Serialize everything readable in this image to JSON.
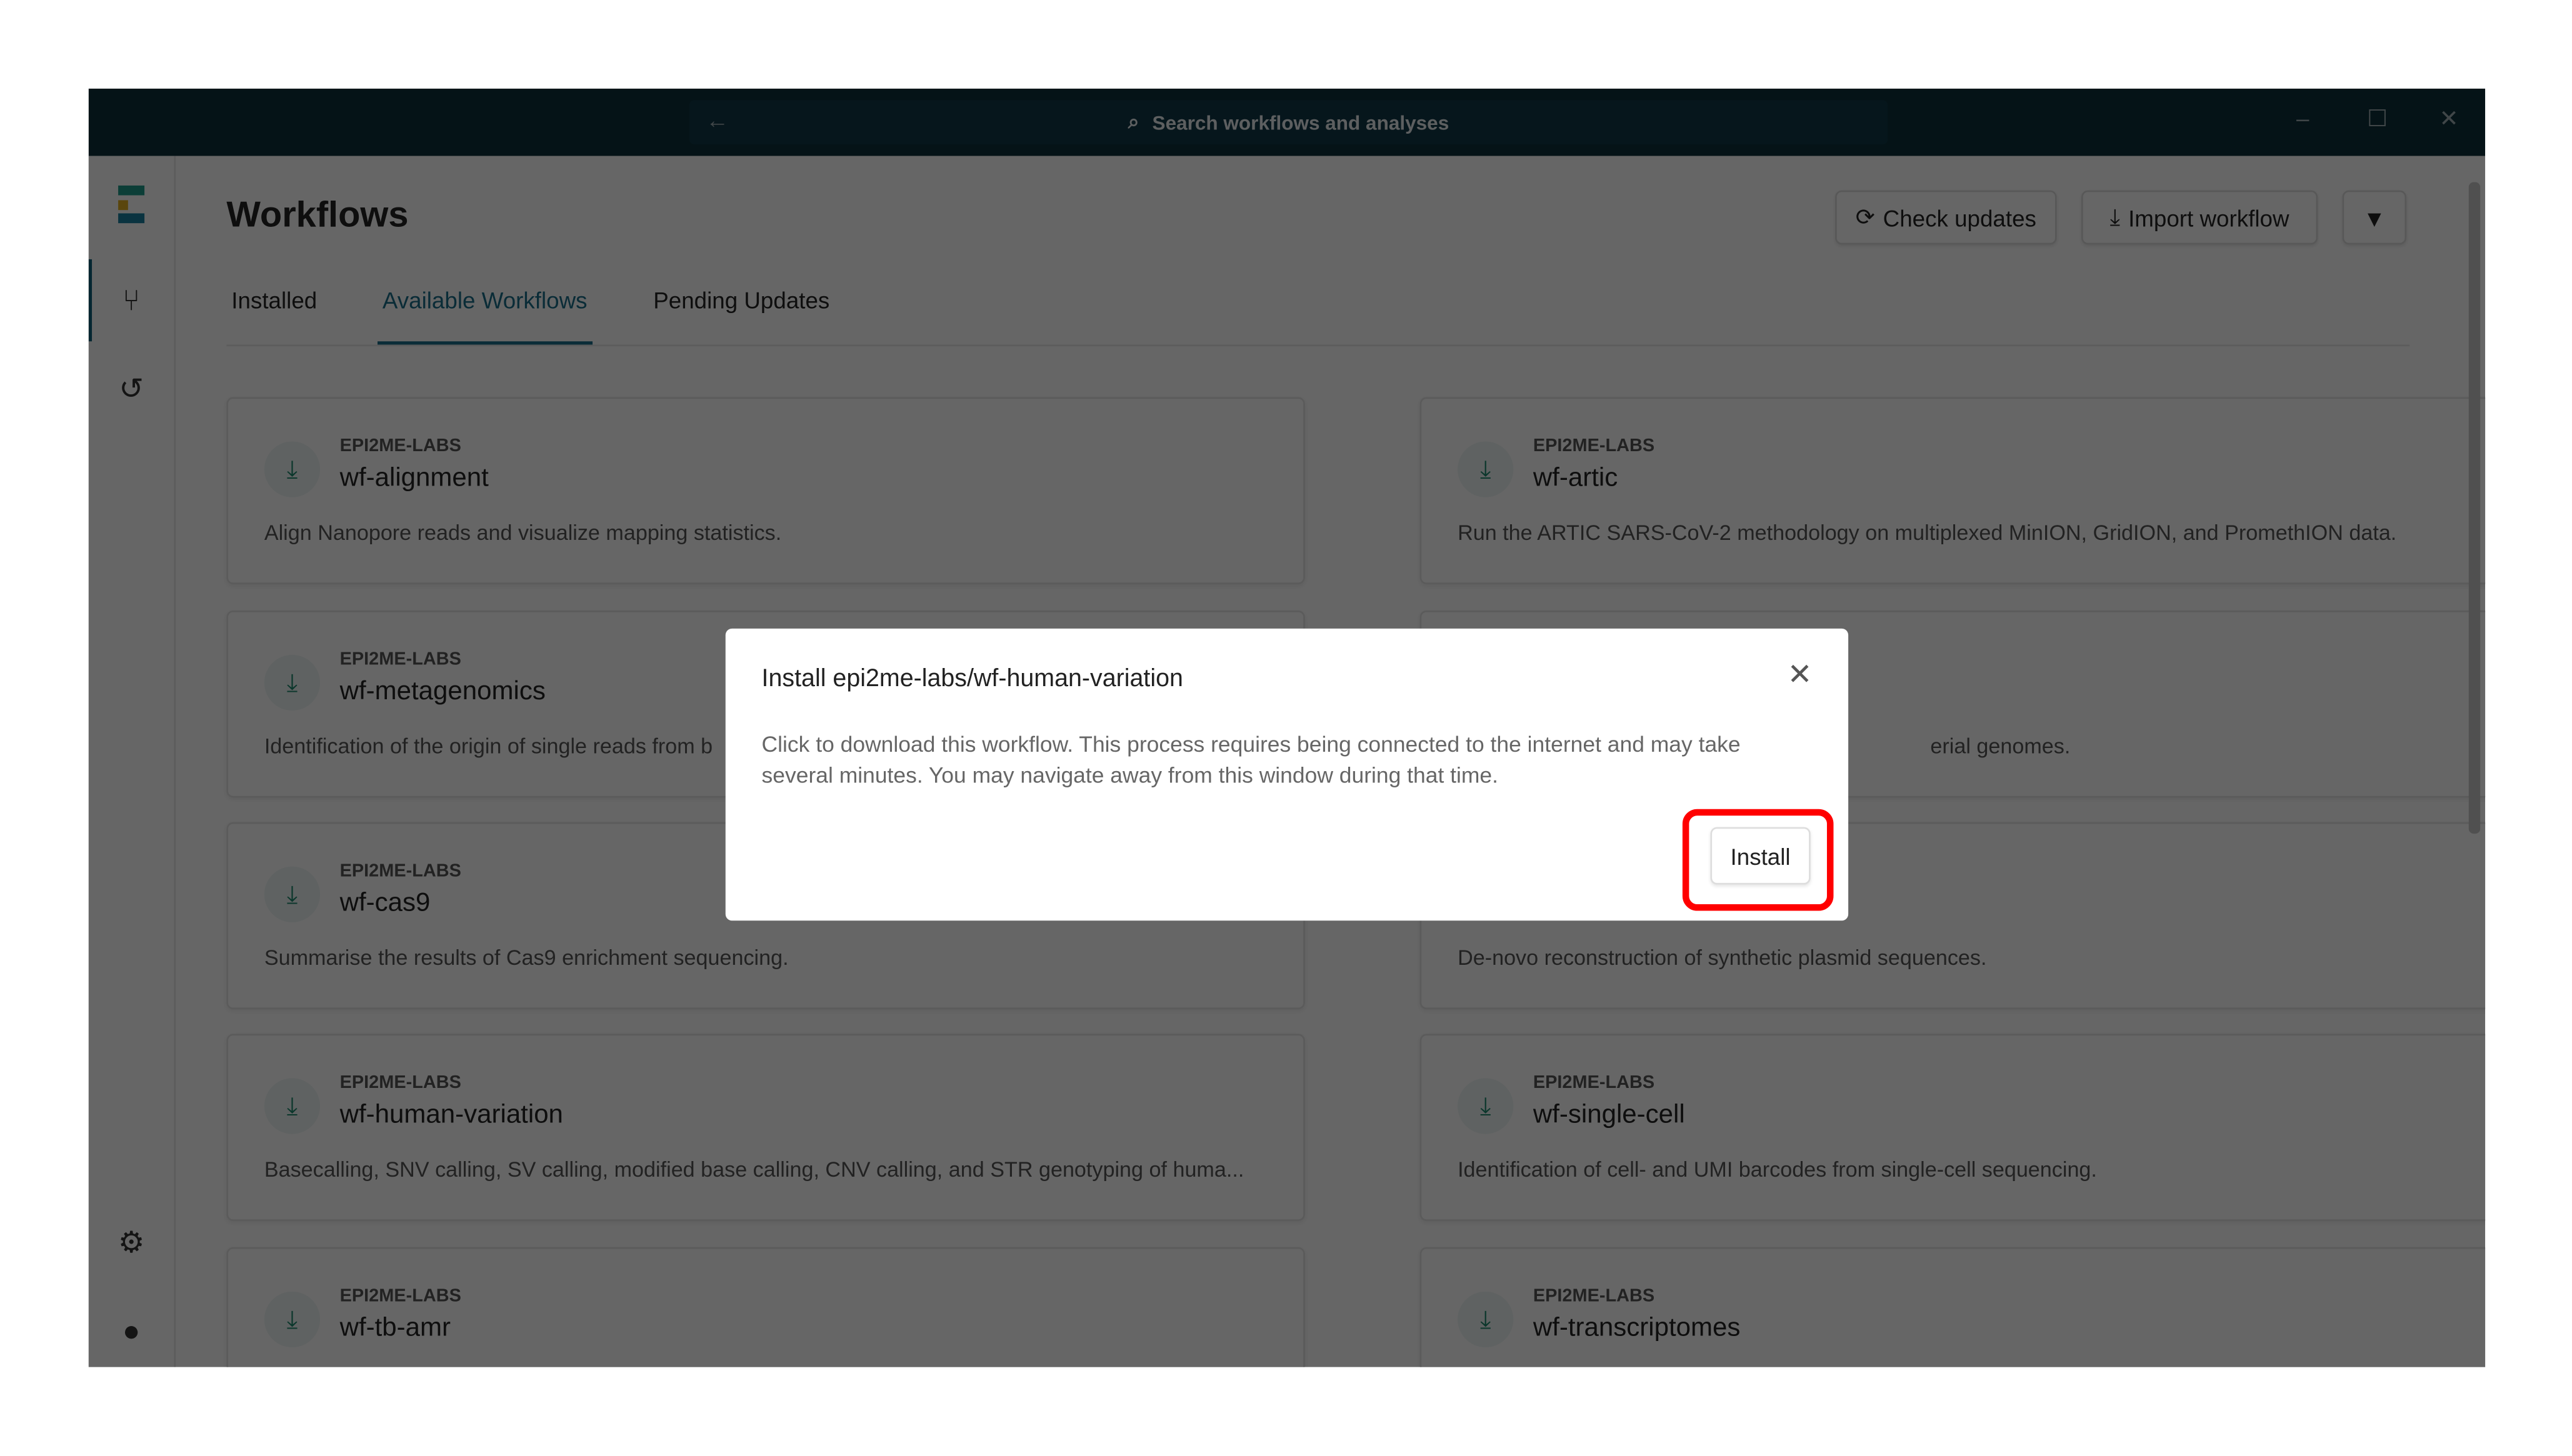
{
  "titlebar": {
    "search_placeholder": "Search workflows and analyses",
    "back": "←",
    "min": "–",
    "max": "☐",
    "close": "✕"
  },
  "header": {
    "title": "Workflows",
    "check_updates": "Check updates",
    "import_workflow": "Import workflow",
    "filter_icon": "▼"
  },
  "tabs": [
    {
      "label": "Installed"
    },
    {
      "label": "Available Workflows",
      "active": true
    },
    {
      "label": "Pending Updates"
    }
  ],
  "cards": [
    {
      "org": "EPI2ME-LABS",
      "name": "wf-alignment",
      "desc": "Align Nanopore reads and visualize mapping statistics."
    },
    {
      "org": "EPI2ME-LABS",
      "name": "wf-artic",
      "desc": "Run the ARTIC SARS-CoV-2 methodology on multiplexed MinION, GridION, and PromethION data."
    },
    {
      "org": "EPI2ME-LABS",
      "name": "wf-metagenomics",
      "desc": "Identification of the origin of single reads from b"
    },
    {
      "org": "",
      "name": "",
      "desc": "erial genomes."
    },
    {
      "org": "EPI2ME-LABS",
      "name": "wf-cas9",
      "desc": "Summarise the results of Cas9 enrichment sequencing."
    },
    {
      "org": "",
      "name": "",
      "desc": "De-novo reconstruction of synthetic plasmid sequences."
    },
    {
      "org": "EPI2ME-LABS",
      "name": "wf-human-variation",
      "desc": "Basecalling, SNV calling, SV calling, modified base calling, CNV calling, and STR genotyping of huma..."
    },
    {
      "org": "EPI2ME-LABS",
      "name": "wf-single-cell",
      "desc": "Identification of cell- and UMI barcodes from single-cell sequencing."
    },
    {
      "org": "EPI2ME-LABS",
      "name": "wf-tb-amr",
      "desc": ""
    },
    {
      "org": "EPI2ME-LABS",
      "name": "wf-transcriptomes",
      "desc": ""
    }
  ],
  "modal": {
    "title": "Install epi2me-labs/wf-human-variation",
    "body": "Click to download this workflow. This process requires being connected to the internet and may take several minutes. You may navigate away from this window during that time.",
    "install": "Install",
    "close": "✕"
  },
  "colors": {
    "titlebar": "#0c2f3a",
    "accent": "#1a6d8a",
    "highlight": "#ff0000",
    "download_icon": "#1d8a6e"
  }
}
